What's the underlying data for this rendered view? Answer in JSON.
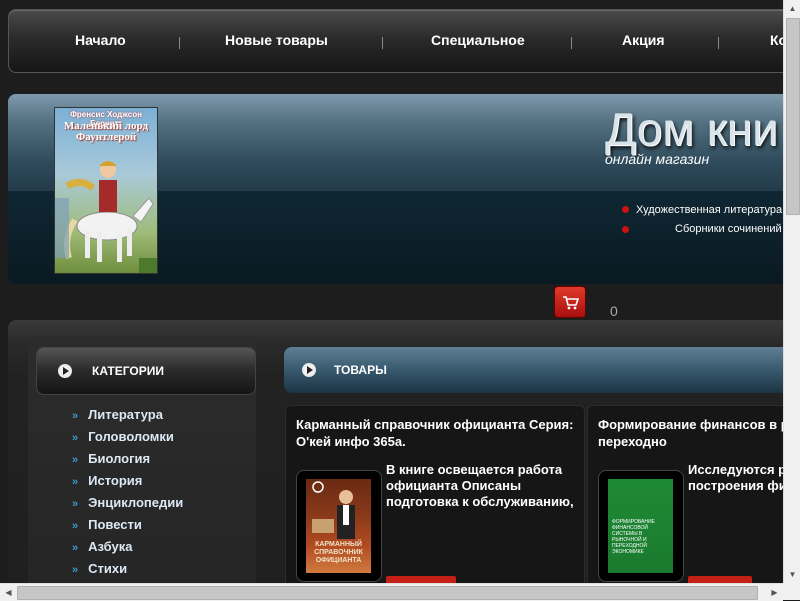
{
  "nav": {
    "items": [
      "Начало",
      "Новые товары",
      "Специальное",
      "Акция",
      "Ко"
    ]
  },
  "header": {
    "title": "Дом кни",
    "subtitle": "онлайн магазин",
    "links": [
      "Художественная литература",
      "Сборники сочинений"
    ],
    "banner_book": {
      "author": "Френсис Ходжсон Бернетт",
      "title": "Маленький лорд Фаунтлерой"
    }
  },
  "cart": {
    "icon": "shopping-cart-icon",
    "count": "0"
  },
  "categories": {
    "title": "КАТЕГОРИИ",
    "items": [
      "Литература",
      "Головоломки",
      "Биология",
      "История",
      "Энциклопедии",
      "Повести",
      "Азбука",
      "Стихи"
    ]
  },
  "products": {
    "title": "ТОВАРЫ",
    "items": [
      {
        "title": "Карманный справочник официанта Серия: О'кей инфо 365а.",
        "description": "В книге освещается работа официанта Описаны подготовка к обслуживанию,",
        "cover_text": "КАРМАННЫЙ СПРАВОЧНИК ОФИЦИАНТА"
      },
      {
        "title": "Формирование финансов в рыночной и переходно",
        "description": "Исследуются различные ас построения финансового",
        "cover_text": "ФОРМИРОВАНИЕ ФИНАНСОВОЙ СИСТЕМЫ В РЫНОЧНОЙ И ПЕРЕХОДНОЙ ЭКОНОМИКЕ"
      }
    ]
  },
  "colors": {
    "accent_red": "#cc1111",
    "category_arrow": "#3d9ccf",
    "banner_blue": "#3e5b71"
  }
}
